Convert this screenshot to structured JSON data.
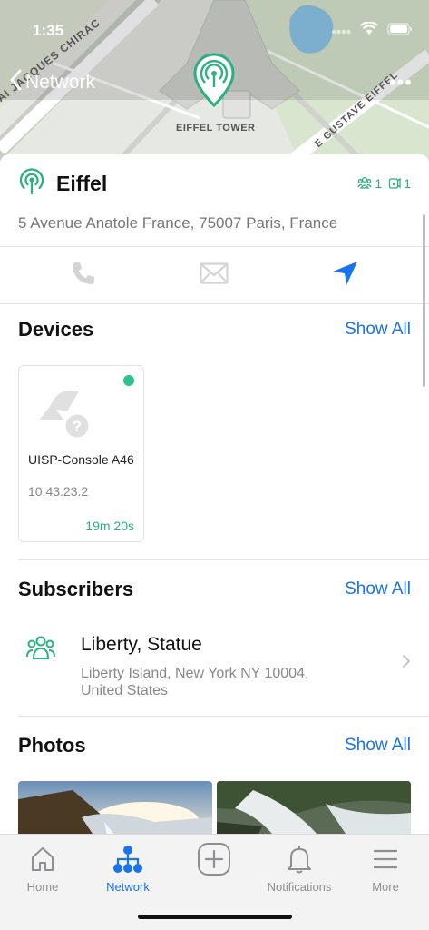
{
  "status_bar": {
    "time": "1:35"
  },
  "nav": {
    "back_label": "Network",
    "more_label": "•••"
  },
  "map": {
    "landmark_label": "EIFFEL TOWER",
    "street_left": "AI JACQUES CHIRAC",
    "street_right": "E GUSTAVE EIFFEL"
  },
  "site": {
    "name": "Eiffel",
    "address": "5 Avenue Anatole France, 75007 Paris, France",
    "subscriber_count": "1",
    "device_count": "1"
  },
  "actions": [
    {
      "icon": "phone-icon"
    },
    {
      "icon": "mail-icon"
    },
    {
      "icon": "navigate-icon"
    }
  ],
  "devices": {
    "title": "Devices",
    "show_all": "Show All",
    "items": [
      {
        "name": "UISP-Console A46",
        "ip": "10.43.23.2",
        "uptime": "19m 20s",
        "status_color": "#2bc48a"
      }
    ]
  },
  "subscribers": {
    "title": "Subscribers",
    "show_all": "Show All",
    "items": [
      {
        "name": "Liberty, Statue",
        "address": "Liberty Island, New York NY 10004, United States"
      }
    ]
  },
  "photos": {
    "title": "Photos",
    "show_all": "Show All"
  },
  "tabbar": {
    "items": [
      {
        "label": "Home",
        "icon": "home-icon"
      },
      {
        "label": "Network",
        "icon": "network-icon",
        "active": true
      },
      {
        "label": "",
        "icon": "add-icon"
      },
      {
        "label": "Notifications",
        "icon": "bell-icon"
      },
      {
        "label": "More",
        "icon": "menu-icon"
      }
    ]
  },
  "colors": {
    "accent": "#1a73e8",
    "brand_green": "#2bb07f",
    "online": "#2bc48a"
  }
}
